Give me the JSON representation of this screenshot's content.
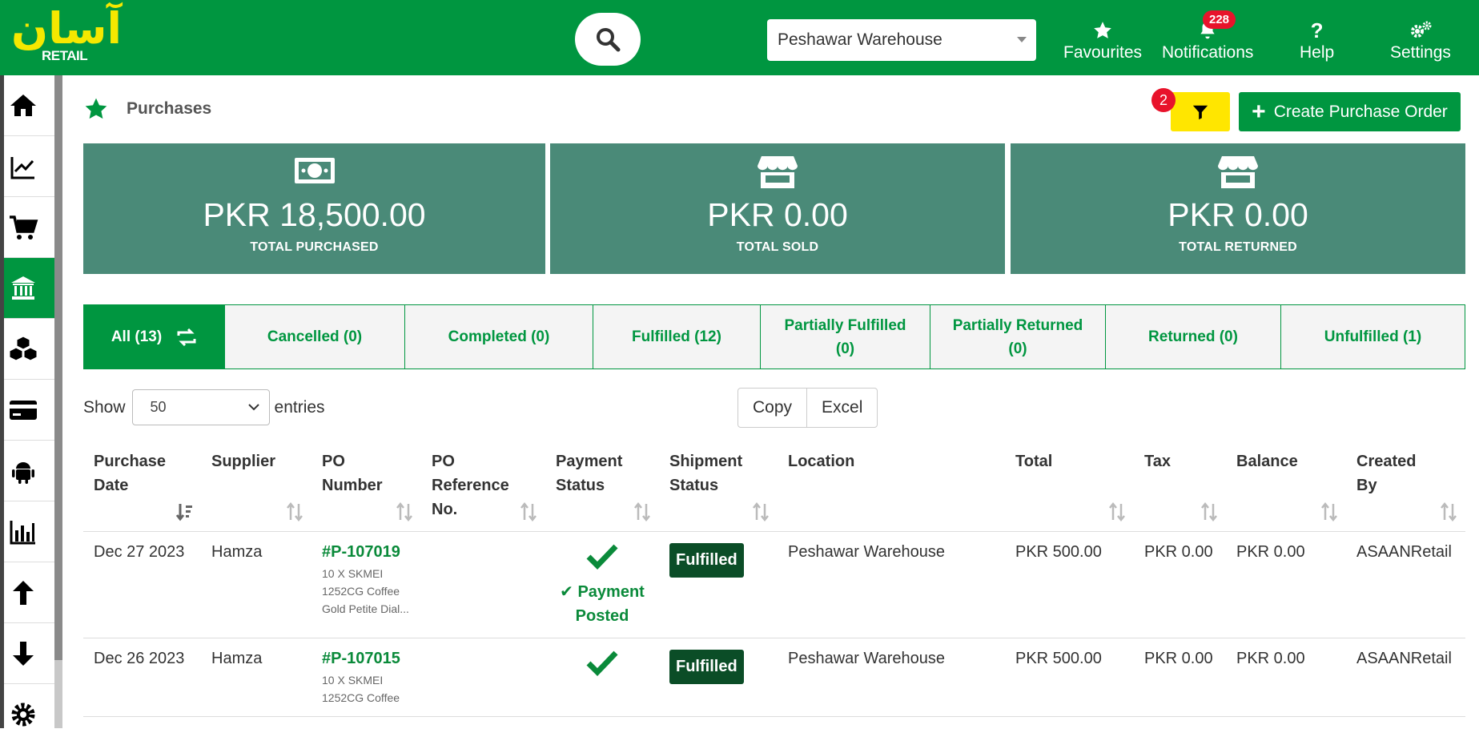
{
  "brand": {
    "logo_urdu": "آسان",
    "logo_word": "RETAIL"
  },
  "header": {
    "warehouse": "Peshawar Warehouse",
    "nav": {
      "favourites": "Favourites",
      "notifications": "Notifications",
      "notifications_count": "228",
      "help": "Help",
      "settings": "Settings"
    }
  },
  "sidebar": {
    "icons": [
      "home-icon",
      "chart-line-icon",
      "cart-icon",
      "bank-icon",
      "boxes-icon",
      "credit-card-icon",
      "android-icon",
      "bar-chart-icon",
      "arrow-up-icon",
      "arrow-down-icon",
      "gear-icon"
    ],
    "active_index": 3
  },
  "page": {
    "title": "Purchases",
    "filter_count": "2",
    "create_label": "Create Purchase Order"
  },
  "stats": [
    {
      "amount": "PKR 18,500.00",
      "label": "TOTAL PURCHASED",
      "icon": "money-icon"
    },
    {
      "amount": "PKR 0.00",
      "label": "TOTAL SOLD",
      "icon": "store-icon"
    },
    {
      "amount": "PKR 0.00",
      "label": "TOTAL RETURNED",
      "icon": "store-icon"
    }
  ],
  "tabs": {
    "all": "All (13)",
    "cancelled": "Cancelled (0)",
    "completed": "Completed (0)",
    "fulfilled": "Fulfilled (12)",
    "partially_fulfilled_1": "Partially Fulfilled",
    "partially_fulfilled_2": "(0)",
    "partially_returned_1": "Partially Returned",
    "partially_returned_2": "(0)",
    "returned": "Returned (0)",
    "unfulfilled": "Unfulfilled (1)"
  },
  "controls": {
    "show_label": "Show",
    "entries_value": "50",
    "entries_label": "entries",
    "copy": "Copy",
    "excel": "Excel"
  },
  "table": {
    "headers": {
      "purchase_date_1": "Purchase",
      "purchase_date_2": "Date",
      "supplier": "Supplier",
      "po_number_1": "PO",
      "po_number_2": "Number",
      "po_ref_1": "PO",
      "po_ref_2": "Reference",
      "po_ref_3": "No.",
      "payment_1": "Payment",
      "payment_2": "Status",
      "shipment_1": "Shipment",
      "shipment_2": "Status",
      "location": "Location",
      "total": "Total",
      "tax": "Tax",
      "balance": "Balance",
      "created_1": "Created",
      "created_2": "By"
    },
    "rows": [
      {
        "date": "Dec 27 2023",
        "supplier": "Hamza",
        "po": "#P-107019",
        "desc_1": "10 X SKMEI",
        "desc_2": "1252CG Coffee",
        "desc_3": "Gold Petite Dial...",
        "payment_text_1": "✔ Payment",
        "payment_text_2": "Posted",
        "shipment": "Fulfilled",
        "location": "Peshawar Warehouse",
        "total": "PKR 500.00",
        "tax": "PKR 0.00",
        "balance": "PKR 0.00",
        "created_by": "ASAANRetail"
      },
      {
        "date": "Dec 26 2023",
        "supplier": "Hamza",
        "po": "#P-107015",
        "desc_1": "10 X SKMEI",
        "desc_2": "1252CG Coffee",
        "shipment": "Fulfilled",
        "location": "Peshawar Warehouse",
        "total": "PKR 500.00",
        "tax": "PKR 0.00",
        "balance": "PKR 0.00",
        "created_by": "ASAANRetail"
      }
    ]
  },
  "colors": {
    "primary": "#009640",
    "stat_bg": "#4a8a78",
    "filter": "#ffe600",
    "badge": "#e8132b",
    "ship_badge": "#0b4d27"
  }
}
